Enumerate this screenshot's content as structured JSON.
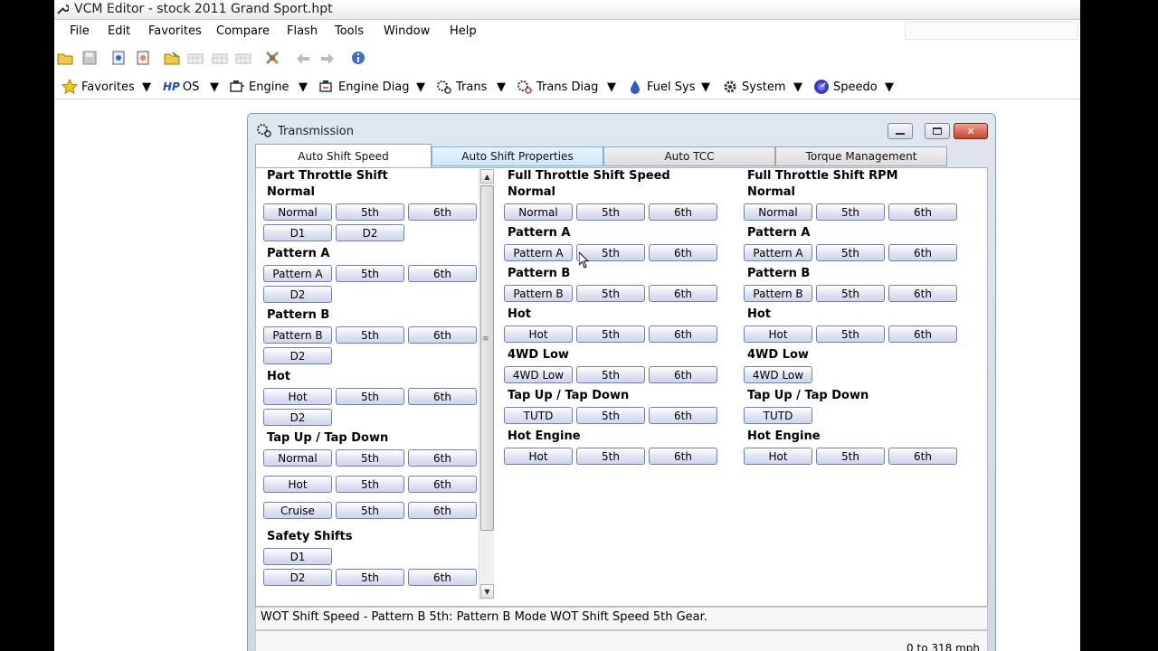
{
  "window": {
    "title": "VCM Editor - stock 2011 Grand Sport.hpt"
  },
  "menu": [
    "File",
    "Edit",
    "Favorites",
    "Compare",
    "Flash",
    "Tools",
    "Window",
    "Help"
  ],
  "categories": [
    "Favorites",
    "OS",
    "Engine",
    "Engine Diag",
    "Trans",
    "Trans Diag",
    "Fuel Sys",
    "System",
    "Speedo"
  ],
  "category_icons": [
    "star-icon",
    "hp-logo-icon",
    "engine-icon",
    "engine-diag-icon",
    "trans-icon",
    "trans-diag-icon",
    "fuel-drop-icon",
    "system-gear-icon",
    "speedo-icon"
  ],
  "os_prefix": "HP",
  "transmission": {
    "title": "Transmission",
    "tabs": [
      "Auto Shift Speed",
      "Auto Shift Properties",
      "Auto TCC",
      "Torque Management"
    ],
    "part_throttle": {
      "heading": "Part Throttle Shift",
      "sections": [
        {
          "label": "Normal",
          "rows": [
            [
              "Normal",
              "5th",
              "6th"
            ],
            [
              "D1",
              "D2"
            ]
          ]
        },
        {
          "label": "Pattern A",
          "rows": [
            [
              "Pattern A",
              "5th",
              "6th"
            ],
            [
              "D2"
            ]
          ]
        },
        {
          "label": "Pattern B",
          "rows": [
            [
              "Pattern B",
              "5th",
              "6th"
            ],
            [
              "D2"
            ]
          ]
        },
        {
          "label": "Hot",
          "rows": [
            [
              "Hot",
              "5th",
              "6th"
            ],
            [
              "D2"
            ]
          ]
        },
        {
          "label": "Tap Up / Tap Down",
          "rows": [
            [
              "Normal",
              "5th",
              "6th"
            ],
            [
              "Hot",
              "5th",
              "6th"
            ],
            [
              "Cruise",
              "5th",
              "6th"
            ]
          ]
        },
        {
          "label": "Safety Shifts",
          "rows": [
            [
              "D1"
            ],
            [
              "D2",
              "5th",
              "6th"
            ]
          ]
        }
      ]
    },
    "full_throttle_speed": {
      "heading": "Full Throttle Shift Speed",
      "sections": [
        {
          "label": "Normal",
          "rows": [
            [
              "Normal",
              "5th",
              "6th"
            ]
          ]
        },
        {
          "label": "Pattern A",
          "rows": [
            [
              "Pattern A",
              "5th",
              "6th"
            ]
          ]
        },
        {
          "label": "Pattern B",
          "rows": [
            [
              "Pattern B",
              "5th",
              "6th"
            ]
          ]
        },
        {
          "label": "Hot",
          "rows": [
            [
              "Hot",
              "5th",
              "6th"
            ]
          ]
        },
        {
          "label": "4WD Low",
          "rows": [
            [
              "4WD Low",
              "5th",
              "6th"
            ]
          ]
        },
        {
          "label": "Tap Up / Tap Down",
          "rows": [
            [
              "TUTD",
              "5th",
              "6th"
            ]
          ]
        },
        {
          "label": "Hot Engine",
          "rows": [
            [
              "Hot",
              "5th",
              "6th"
            ]
          ]
        }
      ]
    },
    "full_throttle_rpm": {
      "heading": "Full Throttle Shift RPM",
      "sections": [
        {
          "label": "Normal",
          "rows": [
            [
              "Normal",
              "5th",
              "6th"
            ]
          ]
        },
        {
          "label": "Pattern A",
          "rows": [
            [
              "Pattern A",
              "5th",
              "6th"
            ]
          ]
        },
        {
          "label": "Pattern B",
          "rows": [
            [
              "Pattern B",
              "5th",
              "6th"
            ]
          ]
        },
        {
          "label": "Hot",
          "rows": [
            [
              "Hot",
              "5th",
              "6th"
            ]
          ]
        },
        {
          "label": "4WD Low",
          "rows": [
            [
              "4WD Low"
            ]
          ]
        },
        {
          "label": "Tap Up / Tap Down",
          "rows": [
            [
              "TUTD"
            ]
          ]
        },
        {
          "label": "Hot Engine",
          "rows": [
            [
              "Hot",
              "5th",
              "6th"
            ]
          ]
        }
      ]
    },
    "status_text": "WOT Shift Speed - Pattern B 5th: Pattern B Mode WOT Shift Speed 5th Gear.",
    "range_text": "0 to 318 mph"
  }
}
